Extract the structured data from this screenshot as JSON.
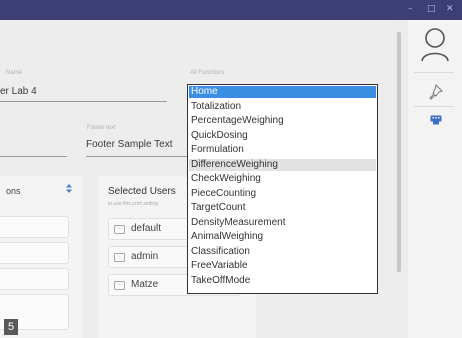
{
  "titlebar": {
    "minimize": "–",
    "maximize": "□",
    "close": "✕"
  },
  "form": {
    "name_label": "Name",
    "name_value": "er Lab 4",
    "all_functions_label": "All Functions",
    "footer_label": "Footer text",
    "footer_value": "Footer Sample Text"
  },
  "left_card": {
    "title": "ons"
  },
  "users": {
    "title": "Selected Users",
    "subtitle": "to use this print setting",
    "items": [
      {
        "name": "default"
      },
      {
        "name": "admin"
      },
      {
        "name": "Matze"
      }
    ]
  },
  "dropdown": {
    "options": [
      "Home",
      "Totalization",
      "PercentageWeighing",
      "QuickDosing",
      "Formulation",
      "DifferenceWeighing",
      "CheckWeighing",
      "PieceCounting",
      "TargetCount",
      "DensityMeasurement",
      "AnimalWeighing",
      "Classification",
      "FreeVariable",
      "TakeOffMode"
    ],
    "selected": "Home",
    "hovered": "DifferenceWeighing"
  },
  "badge": "5",
  "colors": {
    "titlebar": "#3d3e76",
    "selection": "#3b8ee4",
    "rail_icon": "#3a6ec8"
  },
  "icons": [
    "user-icon",
    "pin-icon",
    "usb-drive-icon",
    "sort-icon",
    "image-icon"
  ]
}
